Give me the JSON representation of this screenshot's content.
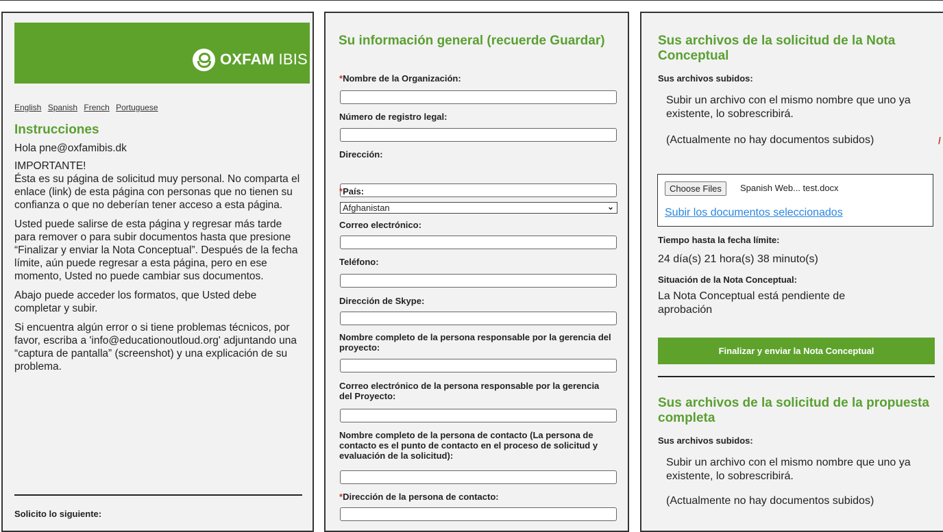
{
  "logo": {
    "brand": "OXFAM",
    "suffix": "IBIS"
  },
  "languages": [
    "English",
    "Spanish",
    "French",
    "Portuguese"
  ],
  "instructions": {
    "title": "Instrucciones",
    "greeting": "Hola pne@oxfamibis.dk",
    "important_label": "IMPORTANTE!",
    "important_text": "Ésta es su página de solicitud muy personal. No comparta el enlace (link) de esta página con personas que no tienen su confianza o que no deberían tener acceso a esta página.",
    "para2": "Usted puede salirse de esta página y regresar más tarde para remover o para subir documentos hasta que presione “Finalizar y enviar la Nota Conceptual”. Después de la fecha límite, aún puede regresar a esta página, pero en ese momento, Usted no puede cambiar sus documentos.",
    "para3": "Abajo puede acceder los formatos, que Usted debe completar y subir.",
    "para4": "Si encuentra algún error o si tiene problemas técnicos, por favor, escriba a 'info@educationoutloud.org' adjuntando una “captura de pantalla” (screenshot) y una explicación de su problema.",
    "bottom_label": "Solicito lo siguiente:"
  },
  "general_info": {
    "title": "Su información general (recuerde Guardar)",
    "required_mark": "*",
    "fields": {
      "org_name": "Nombre de la Organización:",
      "legal_reg": "Número de registro legal:",
      "address": "Dirección:",
      "country": "País:",
      "country_value": "Afghanistan",
      "email": "Correo electrónico:",
      "phone": "Teléfono:",
      "skype": "Dirección de Skype:",
      "manager_name": "Nombre completo de la persona responsable por la gerencia del proyecto:",
      "manager_email": "Correo electrónico de la persona responsable por la gerencia del Proyecto:",
      "contact_name": "Nombre completo de la persona de contacto (La persona de contacto es el punto de contacto en el proceso de solicitud y evaluación de la solicitud):",
      "contact_address": "Dirección de la persona de contacto:"
    }
  },
  "concept_note": {
    "title": "Sus archivos de la solicitud de la Nota Conceptual",
    "uploaded_label": "Sus archivos subidos:",
    "overwrite_note": "Subir un archivo con el mismo nombre que uno ya existente, lo sobrescribirá.",
    "no_docs": "(Actualmente no hay documentos subidos)",
    "choose_files": "Choose Files",
    "file_name": "Spanish Web... test.docx",
    "upload_link": "Subir los documentos seleccionados",
    "deadline_label": "Tiempo hasta la fecha límite:",
    "deadline_value": "24 día(s) 21 hora(s) 38 minuto(s)",
    "status_label": "Situación de la Nota Conceptual:",
    "status_value": "La Nota Conceptual está pendiente de aprobación",
    "submit_label": "Finalizar y enviar la Nota Conceptual"
  },
  "full_proposal": {
    "title": "Sus archivos de la solicitud de la propuesta completa",
    "uploaded_label": "Sus archivos subidos:",
    "overwrite_note": "Subir un archivo con el mismo nombre que uno ya existente, lo sobrescribirá.",
    "no_docs": "(Actualmente no hay documentos subidos)"
  },
  "colors": {
    "brand_green": "#5ea22c",
    "heading_green": "#5aa031",
    "required_red": "#c0392b",
    "link_blue": "#2b86e0"
  }
}
